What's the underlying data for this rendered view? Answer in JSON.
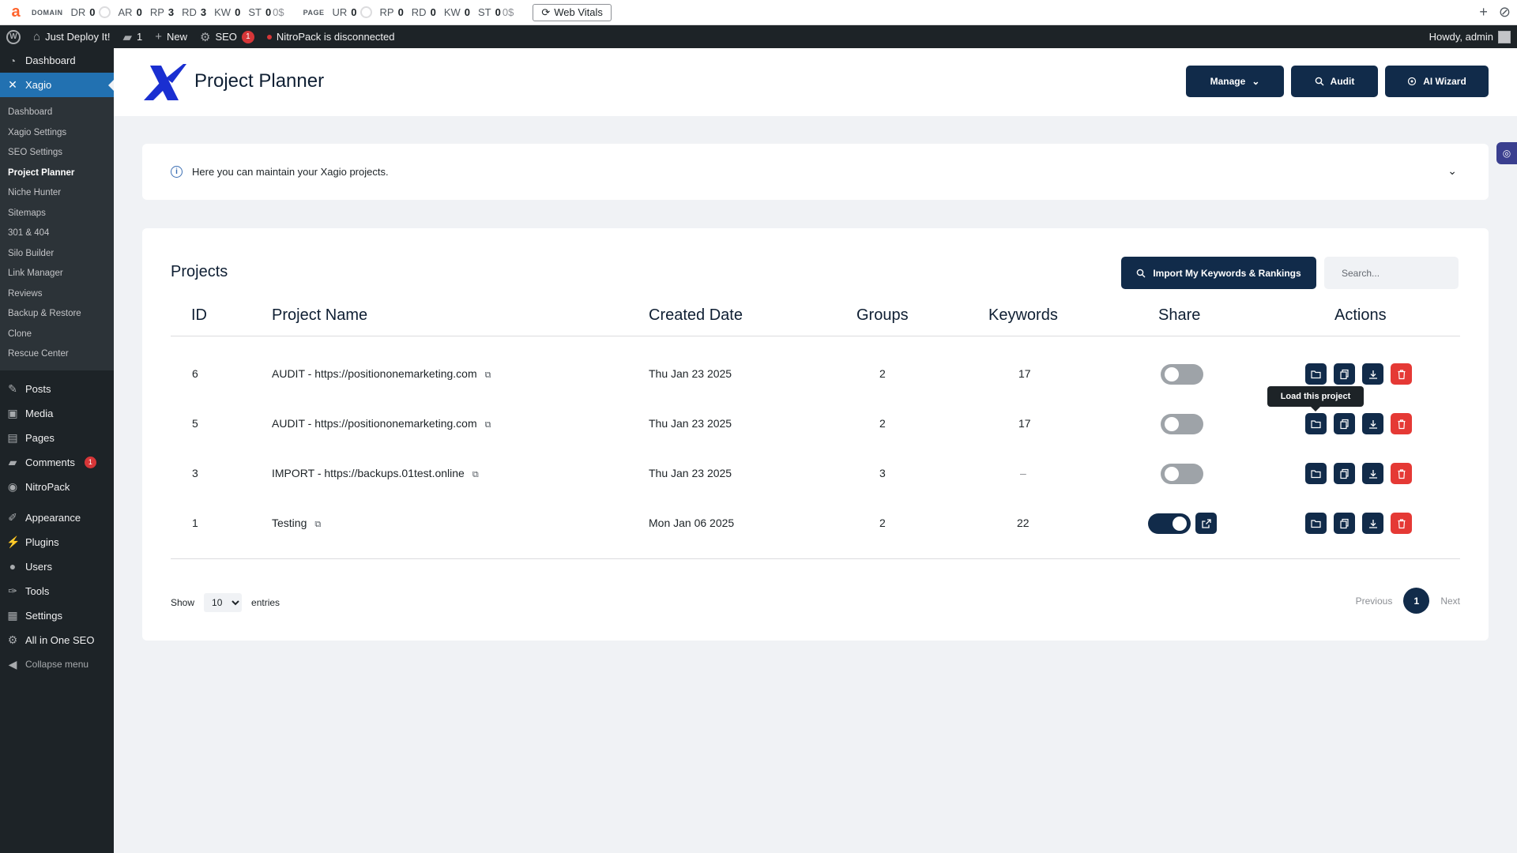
{
  "seo_toolbar": {
    "logo": "a",
    "domain": {
      "label": "DOMAIN",
      "metrics": [
        {
          "k": "DR",
          "v": "0",
          "ring": true
        },
        {
          "k": "AR",
          "v": "0"
        },
        {
          "k": "RP",
          "v": "3"
        },
        {
          "k": "RD",
          "v": "3"
        },
        {
          "k": "KW",
          "v": "0"
        },
        {
          "k": "ST",
          "v": "0",
          "suffix": "0$"
        }
      ]
    },
    "page": {
      "label": "PAGE",
      "metrics": [
        {
          "k": "UR",
          "v": "0",
          "ring": true
        },
        {
          "k": "RP",
          "v": "0"
        },
        {
          "k": "RD",
          "v": "0"
        },
        {
          "k": "KW",
          "v": "0"
        },
        {
          "k": "ST",
          "v": "0",
          "suffix": "0$"
        }
      ]
    },
    "web_vitals": "Web Vitals"
  },
  "admin_bar": {
    "site_name": "Just Deploy It!",
    "comments_count": "1",
    "new_label": "New",
    "seo_label": "SEO",
    "seo_badge": "1",
    "nitropack_status": "NitroPack is disconnected",
    "howdy": "Howdy, admin"
  },
  "sidebar": {
    "dashboard": "Dashboard",
    "xagio": "Xagio",
    "submenu": [
      "Dashboard",
      "Xagio Settings",
      "SEO Settings",
      "Project Planner",
      "Niche Hunter",
      "Sitemaps",
      "301 & 404",
      "Silo Builder",
      "Link Manager",
      "Reviews",
      "Backup & Restore",
      "Clone",
      "Rescue Center"
    ],
    "current_sub": "Project Planner",
    "group1": [
      "Posts",
      "Media",
      "Pages",
      "Comments",
      "NitroPack"
    ],
    "comments_badge": "1",
    "group2": [
      "Appearance",
      "Plugins",
      "Users",
      "Tools",
      "Settings",
      "All in One SEO"
    ],
    "collapse": "Collapse menu"
  },
  "header": {
    "title": "Project Planner",
    "manage": "Manage",
    "audit": "Audit",
    "ai_wizard": "AI Wizard"
  },
  "info": {
    "text": "Here you can maintain your Xagio projects."
  },
  "projects": {
    "title": "Projects",
    "import_button": "Import My Keywords & Rankings",
    "search_placeholder": "Search...",
    "columns": [
      "ID",
      "Project Name",
      "Created Date",
      "Groups",
      "Keywords",
      "Share",
      "Actions"
    ],
    "rows": [
      {
        "id": "6",
        "name": "AUDIT - https://positiononemarketing.com",
        "created": "Thu Jan 23 2025",
        "groups": "2",
        "keywords": "17",
        "shared": false
      },
      {
        "id": "5",
        "name": "AUDIT - https://positiononemarketing.com",
        "created": "Thu Jan 23 2025",
        "groups": "2",
        "keywords": "17",
        "shared": false
      },
      {
        "id": "3",
        "name": "IMPORT - https://backups.01test.online",
        "created": "Thu Jan 23 2025",
        "groups": "3",
        "keywords": "–",
        "shared": false
      },
      {
        "id": "1",
        "name": "Testing",
        "created": "Mon Jan 06 2025",
        "groups": "2",
        "keywords": "22",
        "shared": true
      }
    ],
    "tooltip": "Load this project",
    "show_label": "Show",
    "page_size": "10",
    "entries_label": "entries",
    "previous": "Previous",
    "current_page": "1",
    "next": "Next"
  },
  "colors": {
    "navy": "#112b4a",
    "danger": "#e53935",
    "wp_dark": "#1d2327",
    "wp_blue": "#2271b1"
  }
}
